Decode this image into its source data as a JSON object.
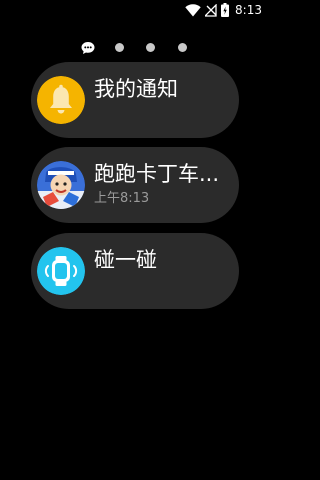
{
  "status_bar": {
    "time": "8:13",
    "icons": [
      "wifi-icon",
      "signal-off-icon",
      "battery-charging-icon"
    ]
  },
  "pager": {
    "pages": 4,
    "current": 1,
    "current_icon": "chat-bubble-icon"
  },
  "cards": [
    {
      "title": "我的通知",
      "subtitle": "",
      "icon": "bell-icon",
      "icon_bg": "#f5b400"
    },
    {
      "title": "跑跑卡丁车...",
      "subtitle": "上午8:13",
      "icon": "game-avatar-icon",
      "icon_bg": "#3a6fd8"
    },
    {
      "title": "碰一碰",
      "subtitle": "",
      "icon": "watch-tap-icon",
      "icon_bg": "#23c4ee"
    }
  ],
  "colors": {
    "background": "#000000",
    "card": "#2b2b2b",
    "secondary_text": "#9a9a9a",
    "dot": "#c8c8c8"
  }
}
